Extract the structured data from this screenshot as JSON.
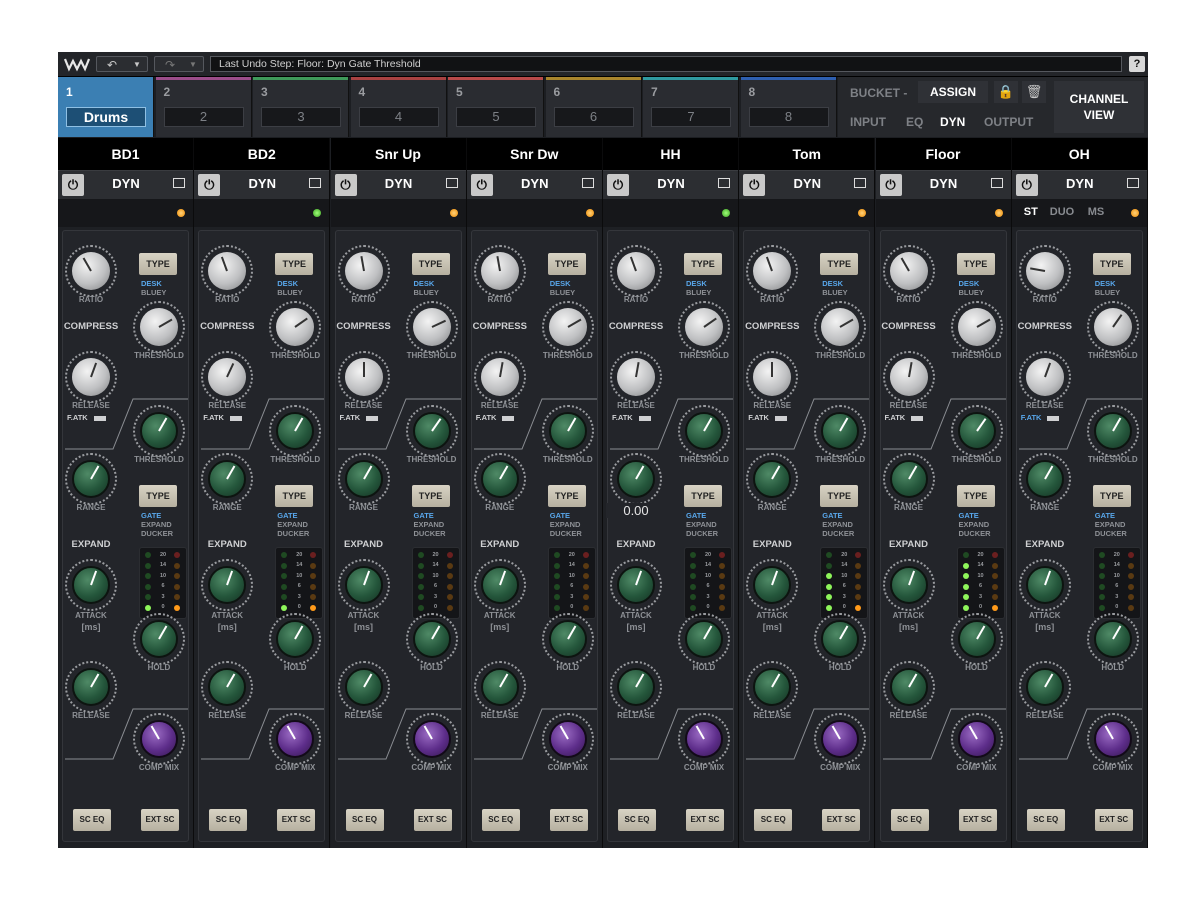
{
  "toolbar": {
    "undo_glyph": "↶",
    "redo_glyph": "↷",
    "undo_info": "Last Undo Step:   Floor: Dyn Gate Threshold",
    "help_label": "?"
  },
  "groups": [
    {
      "number": "1",
      "name": "Drums",
      "active": true,
      "stripe": "#3b7fb3"
    },
    {
      "number": "2",
      "name": "2",
      "active": false,
      "stripe": "#9b4d8a"
    },
    {
      "number": "3",
      "name": "3",
      "active": false,
      "stripe": "#3f9a5a"
    },
    {
      "number": "4",
      "name": "4",
      "active": false,
      "stripe": "#a84242"
    },
    {
      "number": "5",
      "name": "5",
      "active": false,
      "stripe": "#b84a4a"
    },
    {
      "number": "6",
      "name": "6",
      "active": false,
      "stripe": "#a8852d"
    },
    {
      "number": "7",
      "name": "7",
      "active": false,
      "stripe": "#2f9aa0"
    },
    {
      "number": "8",
      "name": "8",
      "active": false,
      "stripe": "#2e5fb0"
    }
  ],
  "right_panel": {
    "bucket_label": "BUCKET -",
    "assign_label": "ASSIGN",
    "lock_glyph": "🔒",
    "trash_glyph": "🗑",
    "tabs": [
      "INPUT",
      "EQ",
      "DYN",
      "OUTPUT"
    ],
    "active_tab": "DYN",
    "channel_view_line1": "CHANNEL",
    "channel_view_line2": "VIEW"
  },
  "strip_labels": {
    "dyn": "DYN",
    "power_glyph": "⏻",
    "type": "TYPE",
    "ratio": "RATIO",
    "compress": "COMPRESS",
    "threshold": "THRESHOLD",
    "release": "RELEASE",
    "fatk": "F.ATK",
    "range": "RANGE",
    "expand": "EXPAND",
    "attack": "ATTACK",
    "ms": "[ms]",
    "hold": "HOLD",
    "comp_mix": "COMP MIX",
    "desk": "DESK",
    "bluey": "BLUEY",
    "gate": "GATE",
    "expand_type": "EXPAND",
    "ducker": "DUCKER",
    "sc_eq": "SC EQ",
    "ext_sc": "EXT SC",
    "meter_scale": [
      "20",
      "14",
      "10",
      "6",
      "3",
      "0"
    ]
  },
  "channels": [
    {
      "name": "BD1",
      "status_led": "orange",
      "readout": "",
      "gr_lit": 1,
      "fatk_active": false
    },
    {
      "name": "BD2",
      "status_led": "green",
      "readout": "",
      "gr_lit": 1,
      "fatk_active": false
    },
    {
      "name": "Snr Up",
      "status_led": "orange",
      "readout": "",
      "gr_lit": 0,
      "fatk_active": false
    },
    {
      "name": "Snr Dw",
      "status_led": "orange",
      "readout": "",
      "gr_lit": 0,
      "fatk_active": false
    },
    {
      "name": "HH",
      "status_led": "green",
      "readout": "0.00",
      "gr_lit": 0,
      "fatk_active": false
    },
    {
      "name": "Tom",
      "status_led": "orange",
      "readout": "",
      "gr_lit": 4,
      "fatk_active": false
    },
    {
      "name": "Floor",
      "status_led": "orange",
      "readout": "",
      "gr_lit": 5,
      "fatk_active": false
    },
    {
      "name": "OH",
      "status_led": "orange",
      "readout": "",
      "gr_lit": 0,
      "fatk_active": true,
      "modes": [
        "ST",
        "DUO",
        "MS"
      ],
      "active_mode": "ST"
    }
  ],
  "colors": {
    "accent_blue": "#3b7fb3",
    "type_highlight": "#58a6ea",
    "led_orange": "#f08a00",
    "led_green": "#3aa020"
  }
}
